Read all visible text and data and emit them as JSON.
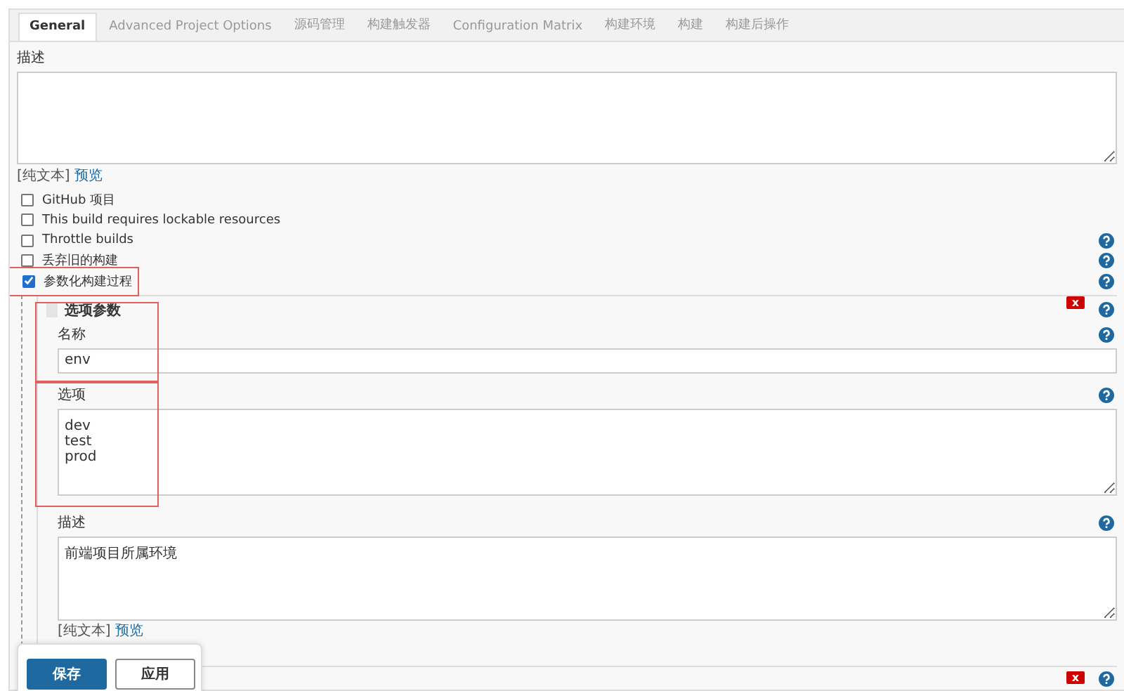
{
  "tabs": [
    {
      "label": "General",
      "selected": true
    },
    {
      "label": "Advanced Project Options",
      "selected": false
    },
    {
      "label": "源码管理",
      "selected": false
    },
    {
      "label": "构建触发器",
      "selected": false
    },
    {
      "label": "Configuration Matrix",
      "selected": false
    },
    {
      "label": "构建环境",
      "selected": false
    },
    {
      "label": "构建",
      "selected": false
    },
    {
      "label": "构建后操作",
      "selected": false
    }
  ],
  "description": {
    "label": "描述",
    "format_note": "[纯文本]",
    "preview_link": "预览"
  },
  "options": [
    {
      "label": "GitHub 项目",
      "checked": false,
      "help": false
    },
    {
      "label": "This build requires lockable resources",
      "checked": false,
      "help": false
    },
    {
      "label": "Throttle builds",
      "checked": false,
      "help": true
    },
    {
      "label": "丢弃旧的构建",
      "checked": false,
      "help": true
    },
    {
      "label": "参数化构建过程",
      "checked": true,
      "help": true,
      "highlighted": true
    }
  ],
  "parameter": {
    "title": "选项参数",
    "delete_label": "x",
    "fields": [
      {
        "kind": "input",
        "label": "名称",
        "value": "env",
        "help": true,
        "highlighted": true
      },
      {
        "kind": "textarea",
        "label": "选项",
        "value": "dev\ntest\nprod",
        "help": true,
        "highlighted": true
      },
      {
        "kind": "textarea",
        "label": "描述",
        "value": "前端项目所属环境",
        "help": true,
        "format_note": "[纯文本]",
        "preview_link": "预览"
      }
    ]
  },
  "next_parameter": {
    "delete_label": "x"
  },
  "buttons": [
    {
      "label": "保存",
      "kind": "primary"
    },
    {
      "label": "应用",
      "kind": "secondary"
    }
  ]
}
